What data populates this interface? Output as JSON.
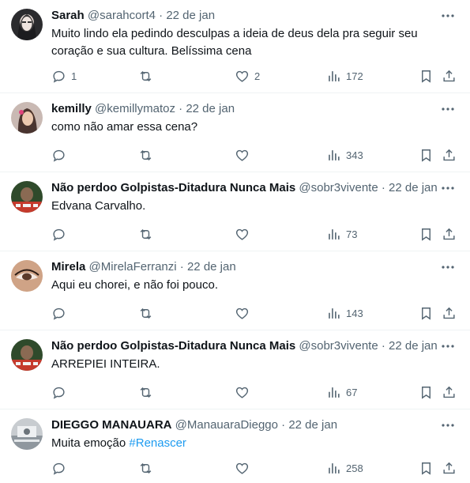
{
  "tweets": [
    {
      "name": "Sarah",
      "handle": "@sarahcort4",
      "separator": "·",
      "date": "22 de jan",
      "text": "Muito lindo ela pedindo desculpas a ideia de deus dela pra seguir seu coração e sua cultura. Belíssima cena",
      "replies": "1",
      "retweets": "",
      "likes": "2",
      "views": "172"
    },
    {
      "name": "kemilly",
      "handle": "@kemillymatoz",
      "separator": "·",
      "date": "22 de jan",
      "text": "como não amar essa cena?",
      "replies": "",
      "retweets": "",
      "likes": "",
      "views": "343"
    },
    {
      "name": "Não perdoo Golpistas-Ditadura Nunca Mais",
      "handle": "@sobr3vivente",
      "separator": "·",
      "date": "22 de jan",
      "text": "Edvana Carvalho.",
      "replies": "",
      "retweets": "",
      "likes": "",
      "views": "73"
    },
    {
      "name": "Mirela",
      "handle": "@MirelaFerranzi",
      "separator": "·",
      "date": "22 de jan",
      "text": "Aqui eu chorei, e não foi pouco.",
      "replies": "",
      "retweets": "",
      "likes": "",
      "views": "143"
    },
    {
      "name": "Não perdoo Golpistas-Ditadura Nunca Mais",
      "handle": "@sobr3vivente",
      "separator": "·",
      "date": "22 de jan",
      "text": "ARREPIEI INTEIRA.",
      "replies": "",
      "retweets": "",
      "likes": "",
      "views": "67"
    },
    {
      "name": "DIEGGO MANAUARA",
      "handle": "@ManauaraDieggo",
      "separator": "·",
      "date": "22 de jan",
      "text": "Muita emoção ",
      "hashtag": "#Renascer",
      "replies": "",
      "retweets": "",
      "likes": "",
      "views": "258"
    }
  ],
  "icons": {
    "reply": "reply-icon",
    "retweet": "retweet-icon",
    "like": "heart-icon",
    "views": "views-icon",
    "bookmark": "bookmark-icon",
    "share": "share-icon",
    "more": "more-icon"
  },
  "colors": {
    "text": "#0f1419",
    "secondary": "#536471",
    "link": "#1d9bf0",
    "divider": "#eff3f4"
  }
}
